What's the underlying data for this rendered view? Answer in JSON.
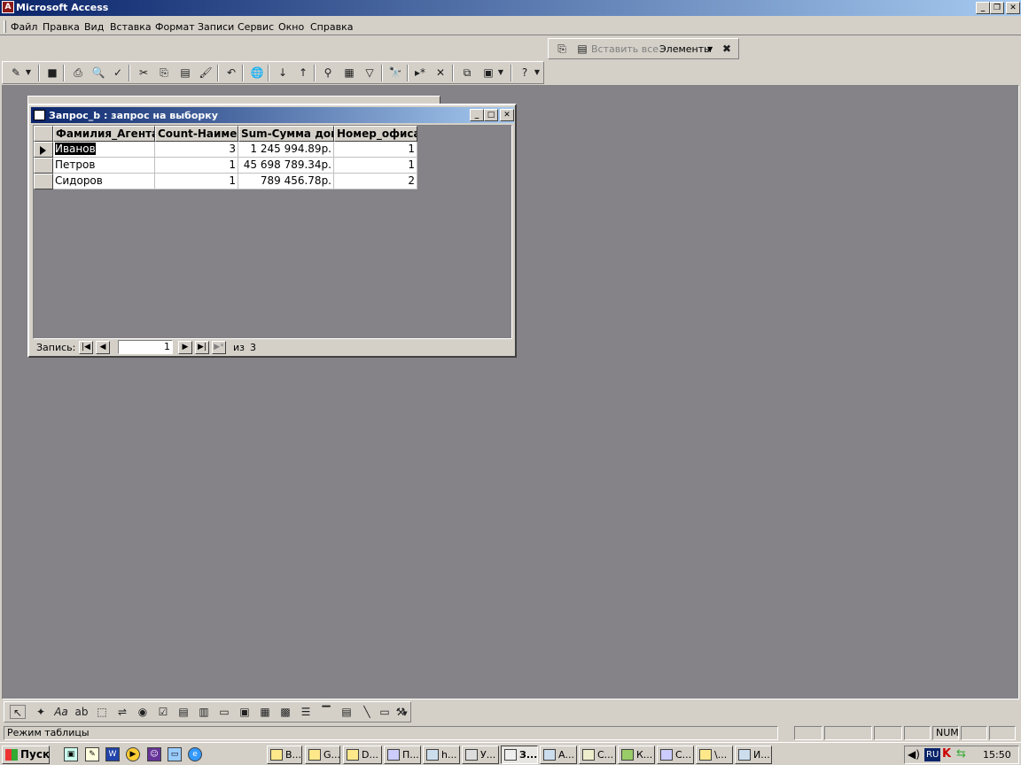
{
  "app": {
    "title": "Microsoft Access"
  },
  "menu": [
    "Файл",
    "Правка",
    "Вид",
    "Вставка",
    "Формат",
    "Записи",
    "Сервис",
    "Окно",
    "Справка"
  ],
  "toolbar2": {
    "paste_all": "Вставить все",
    "elements": "Элементы"
  },
  "query_window": {
    "title": "Запрос_b : запрос на выборку",
    "columns": [
      "Фамилия_Агента",
      "Count-Наимен",
      "Sum-Сумма дого",
      "Номер_офиса"
    ],
    "rows": [
      [
        "Иванов",
        "3",
        "1 245 994.89р.",
        "1"
      ],
      [
        "Петров",
        "1",
        "45 698 789.34р.",
        "1"
      ],
      [
        "Сидоров",
        "1",
        "789 456.78р.",
        "2"
      ]
    ],
    "nav": {
      "label": "Запись:",
      "current": "1",
      "of_label": "из",
      "total": "3"
    }
  },
  "status": {
    "mode": "Режим таблицы",
    "num": "NUM"
  },
  "taskbar": {
    "start": "Пуск",
    "buttons": [
      "В...",
      "G...",
      "D...",
      "П...",
      "h...",
      "У...",
      "З...",
      "А...",
      "С...",
      "К...",
      "С...",
      "\\...",
      "И..."
    ],
    "active_index": 6,
    "lang": "RU",
    "clock": "15:50"
  }
}
